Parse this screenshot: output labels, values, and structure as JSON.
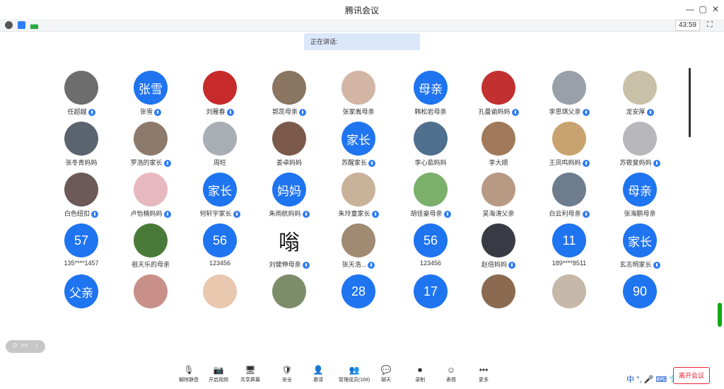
{
  "window": {
    "title": "腾讯会议",
    "minimize": "—",
    "restore": "▢",
    "close": "✕"
  },
  "infobar": {
    "timer": "43:59",
    "fullscreen_icon": "⛶"
  },
  "speaking": {
    "label": "正在讲话:"
  },
  "participants": [
    {
      "name": "任超越",
      "avatar_text": "",
      "color": "#6d6d6d",
      "mic": true
    },
    {
      "name": "张雪",
      "avatar_text": "张雪",
      "color": "#1f74f0",
      "mic": true
    },
    {
      "name": "刘雁春",
      "avatar_text": "",
      "color": "#c62a2a",
      "mic": true
    },
    {
      "name": "郭蕊母亲",
      "avatar_text": "",
      "color": "#8a7560",
      "mic": true
    },
    {
      "name": "张家胤母亲",
      "avatar_text": "",
      "color": "#d3b5a5",
      "mic": false
    },
    {
      "name": "韩松岩母亲",
      "avatar_text": "母亲",
      "color": "#1f74f0",
      "mic": false
    },
    {
      "name": "孔曼谕妈妈",
      "avatar_text": "",
      "color": "#c23030",
      "mic": true
    },
    {
      "name": "李思琪父亲",
      "avatar_text": "",
      "color": "#9aa0a8",
      "mic": true
    },
    {
      "name": "龙安厚",
      "avatar_text": "",
      "color": "#c9c0a8",
      "mic": true
    },
    {
      "name": "张冬青妈妈",
      "avatar_text": "",
      "color": "#5c6470",
      "mic": false
    },
    {
      "name": "罗浩的家长",
      "avatar_text": "",
      "color": "#8d7a6a",
      "mic": true
    },
    {
      "name": "周旺",
      "avatar_text": "",
      "color": "#a9aeb5",
      "mic": false
    },
    {
      "name": "姜卓妈妈",
      "avatar_text": "",
      "color": "#7b5a4c",
      "mic": false
    },
    {
      "name": "苏醒家长",
      "avatar_text": "家长",
      "color": "#1f74f0",
      "mic": true
    },
    {
      "name": "李心茹妈妈",
      "avatar_text": "",
      "color": "#4f6f8f",
      "mic": false
    },
    {
      "name": "李大顺",
      "avatar_text": "",
      "color": "#a07a58",
      "mic": false
    },
    {
      "name": "王凤鸣妈妈",
      "avatar_text": "",
      "color": "#c9a36f",
      "mic": true
    },
    {
      "name": "苏筱斐妈妈",
      "avatar_text": "",
      "color": "#b8b8bc",
      "mic": true
    },
    {
      "name": "白色纽扣",
      "avatar_text": "",
      "color": "#6b5a58",
      "mic": true
    },
    {
      "name": "卢怡楠妈妈",
      "avatar_text": "",
      "color": "#e8b8c0",
      "mic": true
    },
    {
      "name": "何轩宇家长",
      "avatar_text": "家长",
      "color": "#1f74f0",
      "mic": true
    },
    {
      "name": "朱雨航妈妈",
      "avatar_text": "妈妈",
      "color": "#1f74f0",
      "mic": true
    },
    {
      "name": "朱玲童家长",
      "avatar_text": "",
      "color": "#c9b29a",
      "mic": true
    },
    {
      "name": "胡佳豪母亲",
      "avatar_text": "",
      "color": "#7bb06b",
      "mic": true
    },
    {
      "name": "吴海涛父亲",
      "avatar_text": "",
      "color": "#b89a84",
      "mic": false
    },
    {
      "name": "白云利母亲",
      "avatar_text": "",
      "color": "#6e7d8e",
      "mic": true
    },
    {
      "name": "张海鹏母亲",
      "avatar_text": "母亲",
      "color": "#1f74f0",
      "mic": false
    },
    {
      "name": "135****1457",
      "avatar_text": "57",
      "color": "#1f74f0",
      "mic": false
    },
    {
      "name": "祖天乐的母亲",
      "avatar_text": "",
      "color": "#4a7a3a",
      "mic": false
    },
    {
      "name": "123456",
      "avatar_text": "56",
      "color": "#1f74f0",
      "mic": false
    },
    {
      "name": "刘健伸母亲",
      "avatar_text": "嗡",
      "color": "#ffffff",
      "mic": true
    },
    {
      "name": "张天浩...",
      "avatar_text": "",
      "color": "#a08a72",
      "mic": true
    },
    {
      "name": "123456",
      "avatar_text": "56",
      "color": "#1f74f0",
      "mic": false
    },
    {
      "name": "赵倍妈妈",
      "avatar_text": "",
      "color": "#3a3a44",
      "mic": true
    },
    {
      "name": "189****8511",
      "avatar_text": "11",
      "color": "#1f74f0",
      "mic": false
    },
    {
      "name": "玄志明家长",
      "avatar_text": "家长",
      "color": "#1f74f0",
      "mic": true
    },
    {
      "name": "",
      "avatar_text": "父亲",
      "color": "#1f74f0",
      "mic": false
    },
    {
      "name": "",
      "avatar_text": "",
      "color": "#c9908a",
      "mic": false
    },
    {
      "name": "",
      "avatar_text": "",
      "color": "#e9c8b0",
      "mic": false
    },
    {
      "name": "",
      "avatar_text": "",
      "color": "#7d8d6a",
      "mic": false
    },
    {
      "name": "",
      "avatar_text": "28",
      "color": "#1f74f0",
      "mic": false
    },
    {
      "name": "",
      "avatar_text": "17",
      "color": "#1f74f0",
      "mic": false
    },
    {
      "name": "",
      "avatar_text": "",
      "color": "#8a6a50",
      "mic": false
    },
    {
      "name": "",
      "avatar_text": "",
      "color": "#c5b8a8",
      "mic": false
    },
    {
      "name": "",
      "avatar_text": "90",
      "color": "#1f74f0",
      "mic": false
    }
  ],
  "toolbar": {
    "items": [
      {
        "label": "解除静音",
        "icon": "🎙"
      },
      {
        "label": "开启视频",
        "icon": "📷"
      },
      {
        "label": "共享屏幕",
        "icon": "🖥"
      },
      {
        "label": "安全",
        "icon": "🛡"
      },
      {
        "label": "邀请",
        "icon": "👤"
      },
      {
        "label": "管理成员(168)",
        "icon": "👥"
      },
      {
        "label": "聊天",
        "icon": "💬"
      },
      {
        "label": "录制",
        "icon": "⏺"
      },
      {
        "label": "表情",
        "icon": "☺"
      },
      {
        "label": "更多",
        "icon": "•••"
      }
    ],
    "leave": "离开会议"
  },
  "ime": {
    "text": "中 °, 🎤 ⌨ 👕 ⚙"
  }
}
